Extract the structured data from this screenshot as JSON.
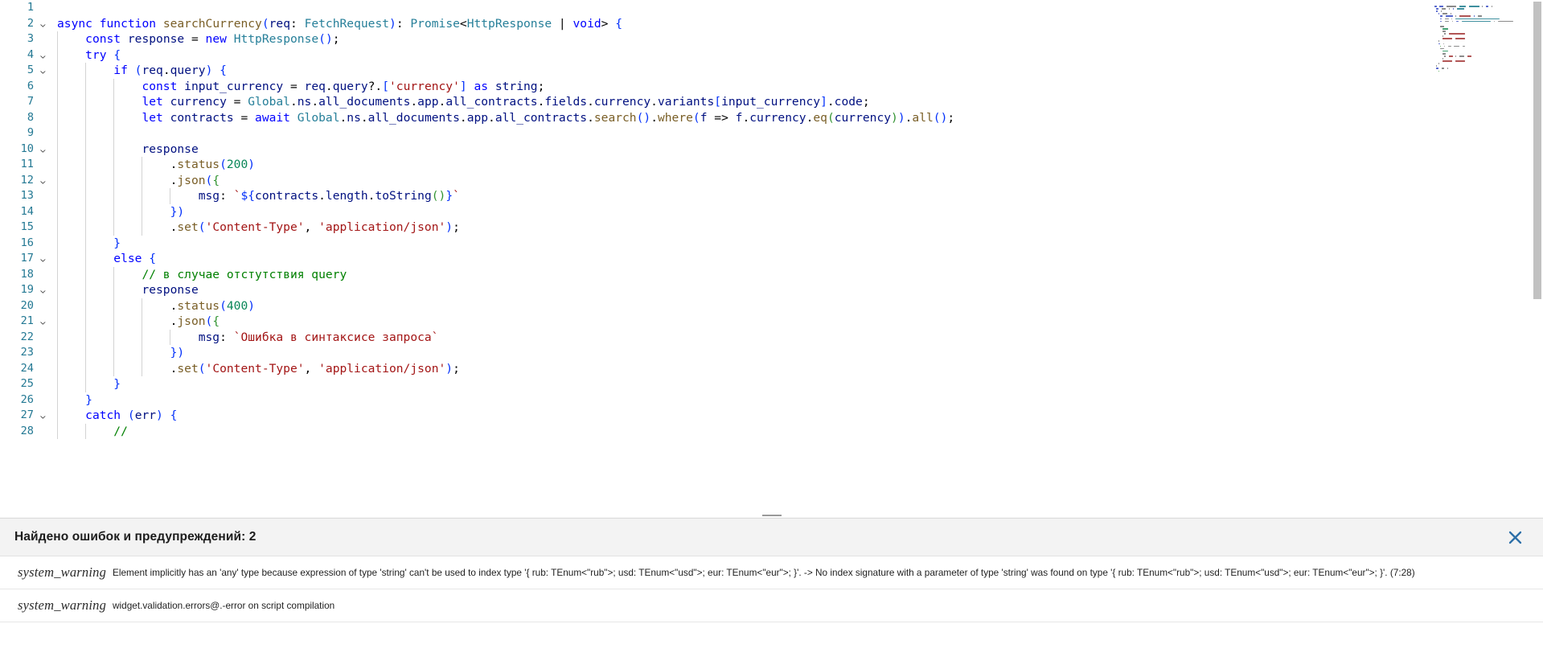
{
  "editor": {
    "language": "typescript",
    "first_visible_line": 1,
    "gutter_color": "#237893",
    "lines": [
      {
        "n": 1,
        "fold": "",
        "guides": 0,
        "text": ""
      },
      {
        "n": 2,
        "fold": "v",
        "guides": 0,
        "text": "async function searchCurrency(req: FetchRequest): Promise<HttpResponse | void> {"
      },
      {
        "n": 3,
        "fold": "",
        "guides": 1,
        "text": "    const response = new HttpResponse();"
      },
      {
        "n": 4,
        "fold": "v",
        "guides": 1,
        "text": "    try {"
      },
      {
        "n": 5,
        "fold": "v",
        "guides": 2,
        "text": "        if (req.query) {"
      },
      {
        "n": 6,
        "fold": "",
        "guides": 3,
        "text": "            const input_currency = req.query?.['currency'] as string;"
      },
      {
        "n": 7,
        "fold": "",
        "guides": 3,
        "text": "            let currency = Global.ns.all_documents.app.all_contracts.fields.currency.variants[input_currency].code;"
      },
      {
        "n": 8,
        "fold": "",
        "guides": 3,
        "text": "            let contracts = await Global.ns.all_documents.app.all_contracts.search().where(f => f.currency.eq(currency)).all();"
      },
      {
        "n": 9,
        "fold": "",
        "guides": 3,
        "text": ""
      },
      {
        "n": 10,
        "fold": "v",
        "guides": 3,
        "text": "            response"
      },
      {
        "n": 11,
        "fold": "",
        "guides": 4,
        "text": "                .status(200)"
      },
      {
        "n": 12,
        "fold": "v",
        "guides": 4,
        "text": "                .json({"
      },
      {
        "n": 13,
        "fold": "",
        "guides": 5,
        "text": "                    msg: `${contracts.length.toString()}`"
      },
      {
        "n": 14,
        "fold": "",
        "guides": 4,
        "text": "                })"
      },
      {
        "n": 15,
        "fold": "",
        "guides": 4,
        "text": "                .set('Content-Type', 'application/json');"
      },
      {
        "n": 16,
        "fold": "",
        "guides": 2,
        "text": "        }"
      },
      {
        "n": 17,
        "fold": "v",
        "guides": 2,
        "text": "        else {"
      },
      {
        "n": 18,
        "fold": "",
        "guides": 3,
        "text": "            // в случае отстутствия query"
      },
      {
        "n": 19,
        "fold": "v",
        "guides": 3,
        "text": "            response"
      },
      {
        "n": 20,
        "fold": "",
        "guides": 4,
        "text": "                .status(400)"
      },
      {
        "n": 21,
        "fold": "v",
        "guides": 4,
        "text": "                .json({"
      },
      {
        "n": 22,
        "fold": "",
        "guides": 5,
        "text": "                    msg: `Ошибка в синтаксисе запроса`"
      },
      {
        "n": 23,
        "fold": "",
        "guides": 4,
        "text": "                })"
      },
      {
        "n": 24,
        "fold": "",
        "guides": 4,
        "text": "                .set('Content-Type', 'application/json');"
      },
      {
        "n": 25,
        "fold": "",
        "guides": 2,
        "text": "        }"
      },
      {
        "n": 26,
        "fold": "",
        "guides": 1,
        "text": "    }"
      },
      {
        "n": 27,
        "fold": "v",
        "guides": 1,
        "text": "    catch (err) {"
      },
      {
        "n": 28,
        "fold": "",
        "guides": 2,
        "text": "        //"
      }
    ]
  },
  "minimap": {
    "name": "code-minimap",
    "visible": true
  },
  "scrollbar": {
    "vertical_thumb_visible": true
  },
  "panel": {
    "title": "Найдено ошибок и предупреждений: 2",
    "close_label": "×",
    "close_icon": "close-icon",
    "accent_color": "#2c6fa8",
    "warnings": [
      {
        "kind": "system_warning",
        "message": "Element implicitly has an 'any' type because expression of type 'string' can't be used to index type '{ rub: TEnum<\"rub\">; usd: TEnum<\"usd\">; eur: TEnum<\"eur\">; }'. -> No index signature with a parameter of type 'string' was found on type '{ rub: TEnum<\"rub\">; usd: TEnum<\"usd\">; eur: TEnum<\"eur\">; }'. (7:28)"
      },
      {
        "kind": "system_warning",
        "message": "widget.validation.errors@.-error on script compilation"
      }
    ]
  }
}
